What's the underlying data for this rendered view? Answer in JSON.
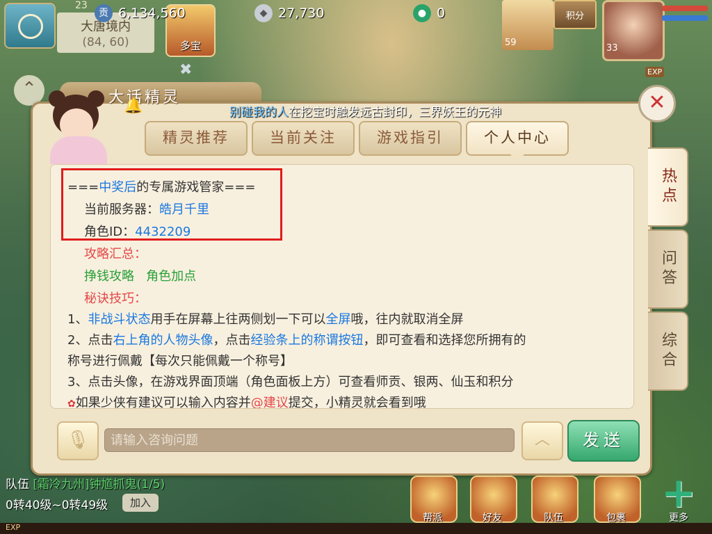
{
  "hud": {
    "player_level": "23",
    "location_name": "大唐境内",
    "location_coords": "(84, 60)",
    "currency_shigong": "6,134,560",
    "currency_silver": "27,730",
    "currency_jade": "0",
    "duobao_label": "多宝",
    "pet_level": "59",
    "score_label": "积分",
    "hero_level": "33",
    "exp_tag": "EXP"
  },
  "dialog": {
    "title": "大话精灵",
    "marquee_highlight": "别碰我的人",
    "marquee_rest": "在挖宝时触发远古封印，三界妖王的元神",
    "tabs": [
      "精灵推荐",
      "当前关注",
      "游戏指引",
      "个人中心"
    ],
    "active_tab": 3,
    "side_tabs": [
      "热点",
      "问答",
      "综合"
    ],
    "active_side_tab": 0,
    "content": {
      "header_prefix": "===",
      "header_highlight": "中奖后",
      "header_rest": "的专属游戏管家===",
      "server_label": "当前服务器：",
      "server_value": "皓月千里",
      "role_label": "角色ID：",
      "role_value": "4432209",
      "guide_title": "攻略汇总：",
      "guide_link1": "挣钱攻略",
      "guide_link2": "角色加点",
      "tips_title": "秘诀技巧：",
      "tip1_prefix": "1、",
      "tip1_hl1": "非战斗状态",
      "tip1_mid": "用手在屏幕上往两侧划一下可以",
      "tip1_hl2": "全屏",
      "tip1_end": "哦，往内就取消全屏",
      "tip2_prefix": "2、点击",
      "tip2_hl1": "右上角的人物头像",
      "tip2_mid": "，点击",
      "tip2_hl2": "经验条上的称谓按钮",
      "tip2_end": "，即可查看和选择您所拥有的",
      "tip2_line2": "称号进行佩戴【每次只能佩戴一个称号】",
      "tip3": "3、点击头像，在游戏界面顶端（角色面板上方）可查看师贡、银两、仙玉和积分",
      "tip4_prefix": "如果少侠有建议可以输入内容并",
      "tip4_hl": "@建议",
      "tip4_end": "提交，小精灵就会看到哦"
    },
    "input_placeholder": "请输入咨询问题",
    "send_label": "发送"
  },
  "bottom": {
    "team_prefix": "队伍",
    "team_task": "[霜冷九州]钟馗抓鬼(1/5)",
    "level_range": "0转40级~0转49级",
    "join_label": "加入",
    "buttons": [
      "帮派",
      "好友",
      "队伍",
      "包裹",
      "更多"
    ],
    "exp_label": "EXP"
  },
  "colors": {
    "link_blue": "#1a78e0",
    "section_red": "#e34848",
    "link_green": "#28a038",
    "highlight_border": "#e01c1c",
    "send_green": "#36a86e"
  },
  "icons": [
    "map-icon",
    "coin-icon",
    "silver-icon",
    "jade-icon",
    "bell-icon",
    "close-icon",
    "mic-icon",
    "chevron-up-icon",
    "flower-icon",
    "plus-icon",
    "sword-icon"
  ]
}
